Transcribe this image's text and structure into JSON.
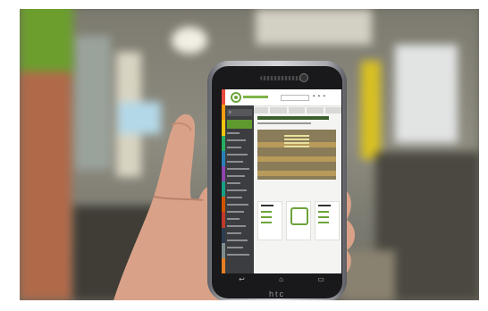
{
  "phone": {
    "brand_logo": "htc",
    "nav_icons": [
      "back-icon",
      "home-icon",
      "recent-apps-icon"
    ],
    "nav_glyphs": [
      "↩",
      "⌂",
      "▭"
    ]
  },
  "colors": {
    "accent_green": "#6da33a",
    "sidebar_dark": "#3b3d40",
    "rail_colors": [
      "#e84c3d",
      "#f39c12",
      "#f1c40f",
      "#27ae60",
      "#2980b9",
      "#8e44ad",
      "#16a085",
      "#d35400",
      "#c0392b",
      "#2c3e50",
      "#7f8c8d",
      "#e67e22"
    ]
  }
}
